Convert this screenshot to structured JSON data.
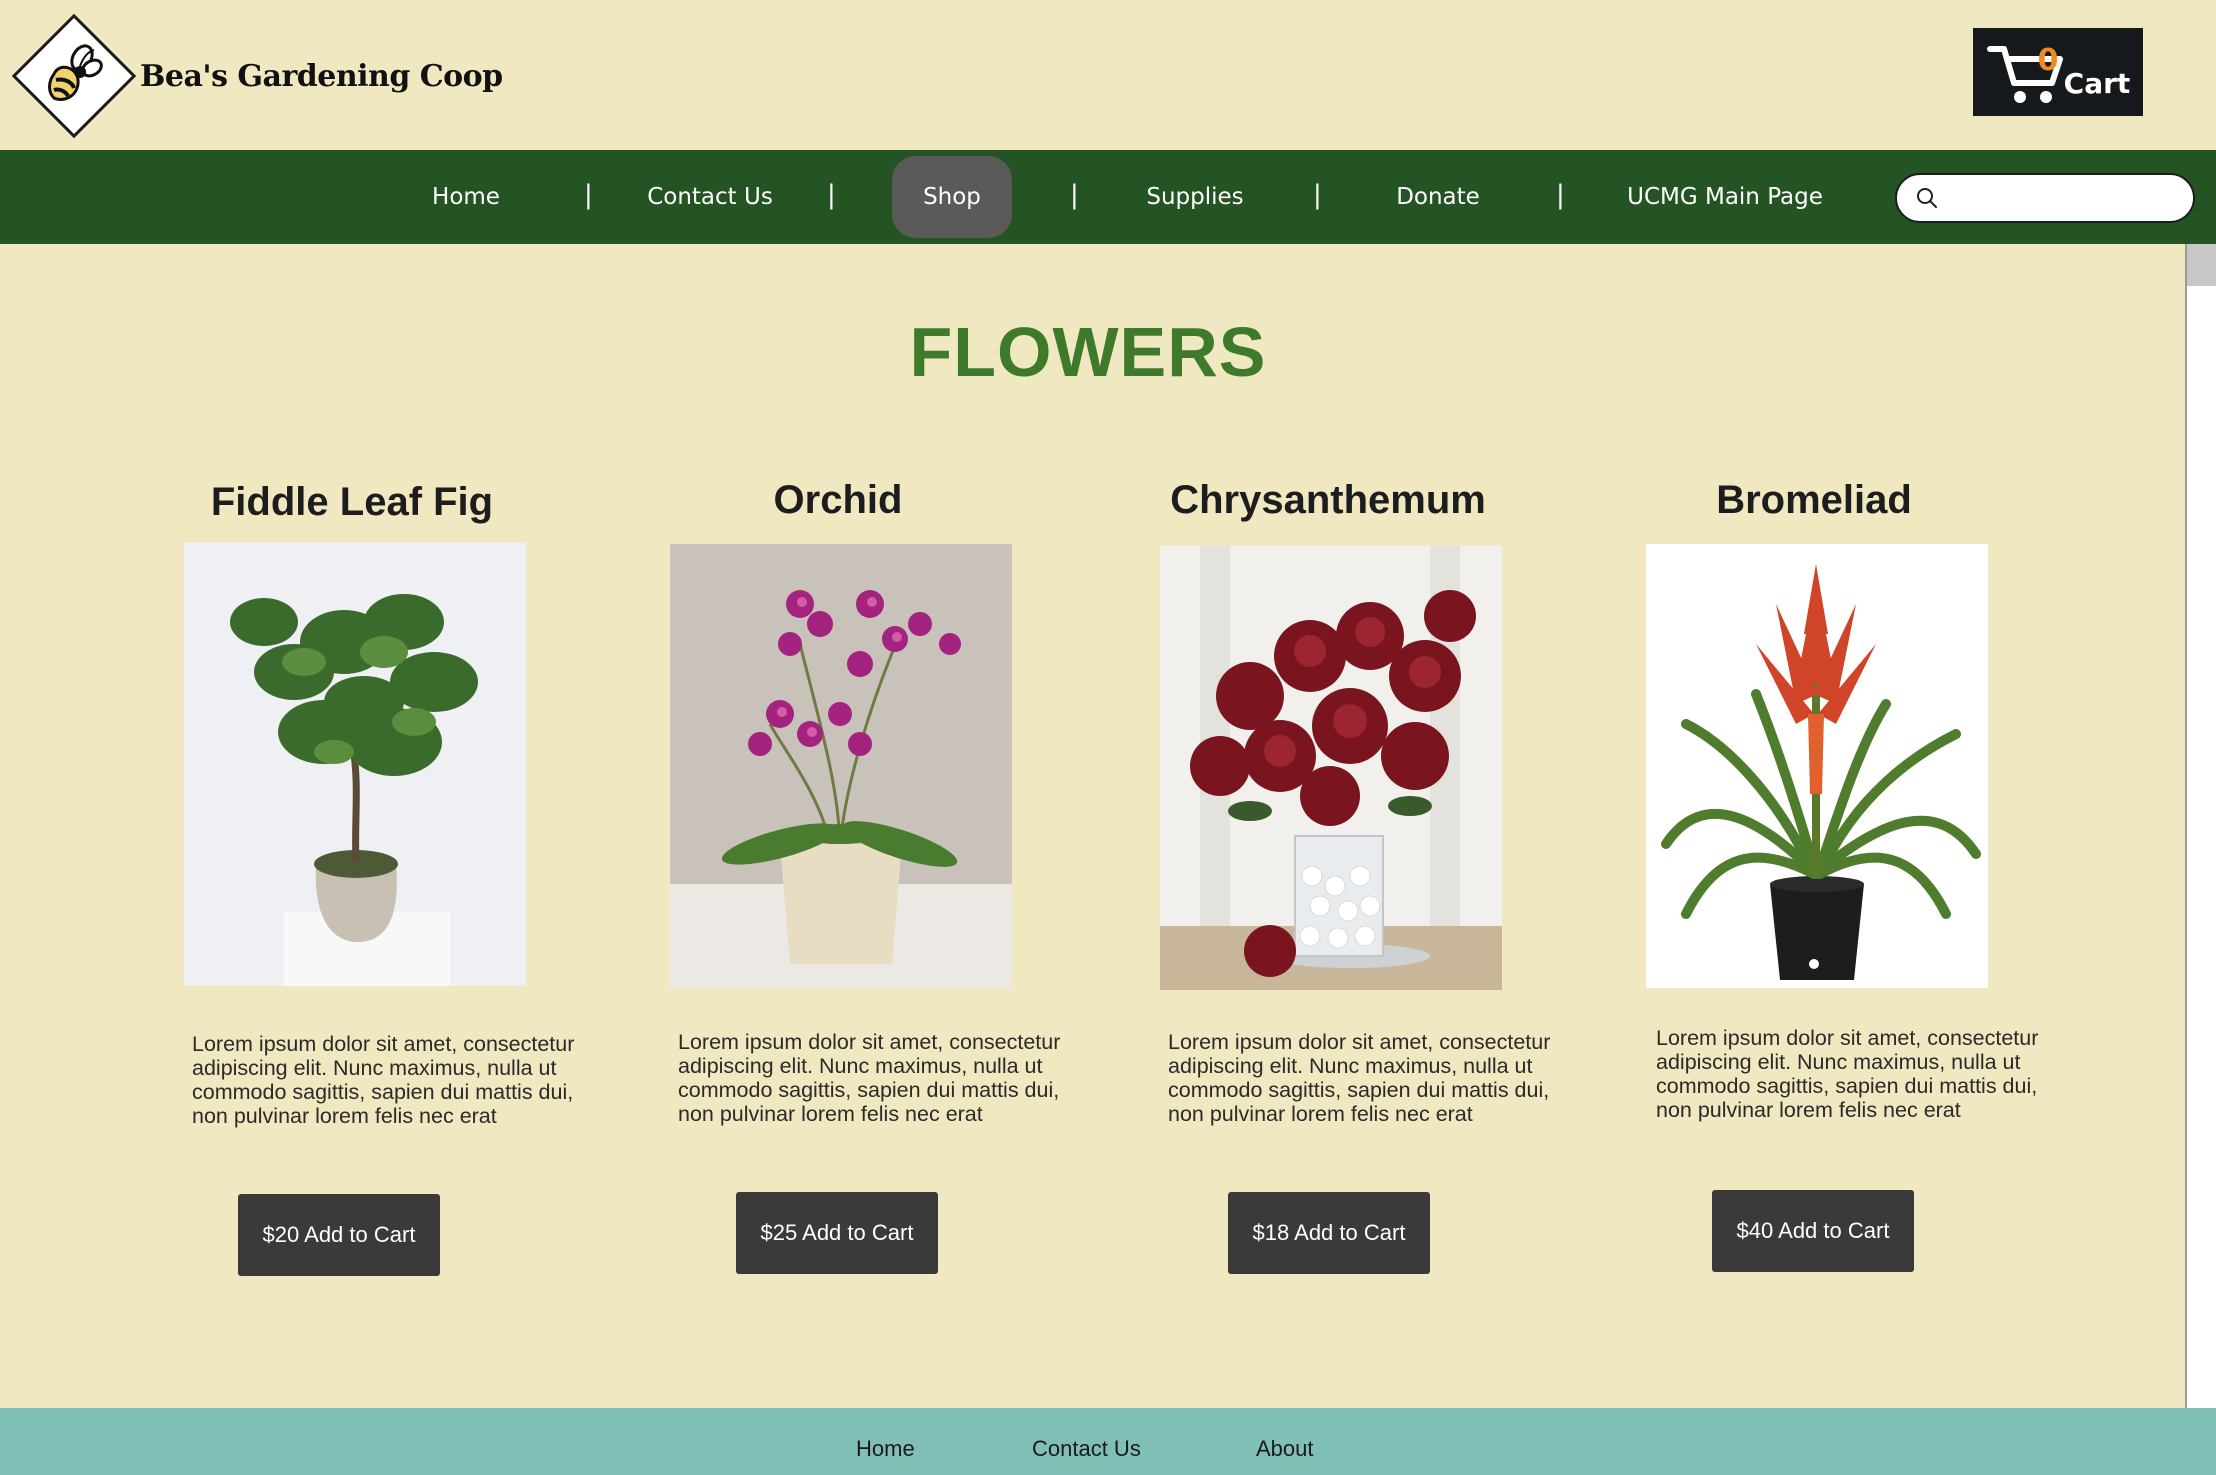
{
  "header": {
    "logo_text": "Bea's Gardening Coop",
    "cart": {
      "count": "0",
      "label": "Cart"
    }
  },
  "nav": {
    "items": [
      {
        "label": "Home",
        "active": false
      },
      {
        "label": "Contact Us",
        "active": false
      },
      {
        "label": "Shop",
        "active": true
      },
      {
        "label": "Supplies",
        "active": false
      },
      {
        "label": "Donate",
        "active": false
      },
      {
        "label": "UCMG Main Page",
        "active": false
      }
    ],
    "separator": "|",
    "search": {
      "value": "",
      "placeholder": ""
    }
  },
  "page": {
    "title": "FLOWERS"
  },
  "products": [
    {
      "name": "Fiddle Leaf Fig",
      "image_icon": "fiddle-leaf-fig-plant",
      "description": "Lorem ipsum dolor sit amet, consectetur adipiscing elit. Nunc maximus, nulla ut commodo sagittis, sapien dui mattis dui, non pulvinar lorem felis nec erat",
      "button_label": "$20 Add to Cart"
    },
    {
      "name": "Orchid",
      "image_icon": "orchid-plant",
      "description": "Lorem ipsum dolor sit amet, consectetur adipiscing elit. Nunc maximus, nulla ut commodo sagittis, sapien dui mattis dui, non pulvinar lorem felis nec erat",
      "button_label": "$25 Add to Cart"
    },
    {
      "name": "Chrysanthemum",
      "image_icon": "chrysanthemum-bouquet",
      "description": "Lorem ipsum dolor sit amet, consectetur adipiscing elit. Nunc maximus, nulla ut commodo sagittis, sapien dui mattis dui, non pulvinar lorem felis nec erat",
      "button_label": "$18 Add to Cart"
    },
    {
      "name": "Bromeliad",
      "image_icon": "bromeliad-plant",
      "description": "Lorem ipsum dolor sit amet, consectetur adipiscing elit. Nunc maximus, nulla ut commodo sagittis, sapien dui mattis dui, non pulvinar lorem felis nec erat",
      "button_label": "$40 Add to Cart"
    }
  ],
  "footer": {
    "links": [
      {
        "label": "Home"
      },
      {
        "label": "Contact Us"
      },
      {
        "label": "About"
      }
    ]
  },
  "colors": {
    "background": "#efe8c0",
    "nav_green": "#255424",
    "title_green": "#3f7a2b",
    "active_tab": "#5a5a58",
    "button_dark": "#3a3a3a",
    "cart_bg": "#15191c",
    "cart_count": "#f08a1c",
    "footer_teal": "#80bfb5"
  }
}
